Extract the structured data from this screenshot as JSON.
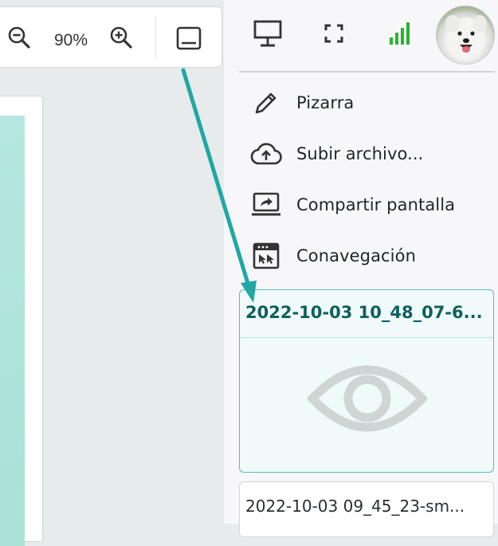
{
  "toolbar": {
    "zoom_level": "90%",
    "icons": [
      "zoom-out-icon",
      "zoom-in-icon",
      "bottom-panel-icon"
    ]
  },
  "panel_top": {
    "icons": [
      "presentation-icon",
      "fullscreen-icon",
      "signal-strength-icon",
      "user-avatar"
    ],
    "signal_color": "#27b52f"
  },
  "menu": {
    "items": [
      {
        "label": "Pizarra",
        "icon": "pencil-icon"
      },
      {
        "label": "Subir archivo...",
        "icon": "cloud-upload-icon"
      },
      {
        "label": "Compartir pantalla",
        "icon": "screen-share-icon"
      },
      {
        "label": "Conavegación",
        "icon": "cobrowse-icon"
      }
    ]
  },
  "files": [
    {
      "name": "2022-10-03 10_48_07-6...",
      "active": true
    },
    {
      "name": "2022-10-03 09_45_23-sm...",
      "active": false
    }
  ],
  "colors": {
    "accent": "#4fc0b9",
    "active_title": "#0f5f5c",
    "arrow": "#1fa8a4"
  }
}
